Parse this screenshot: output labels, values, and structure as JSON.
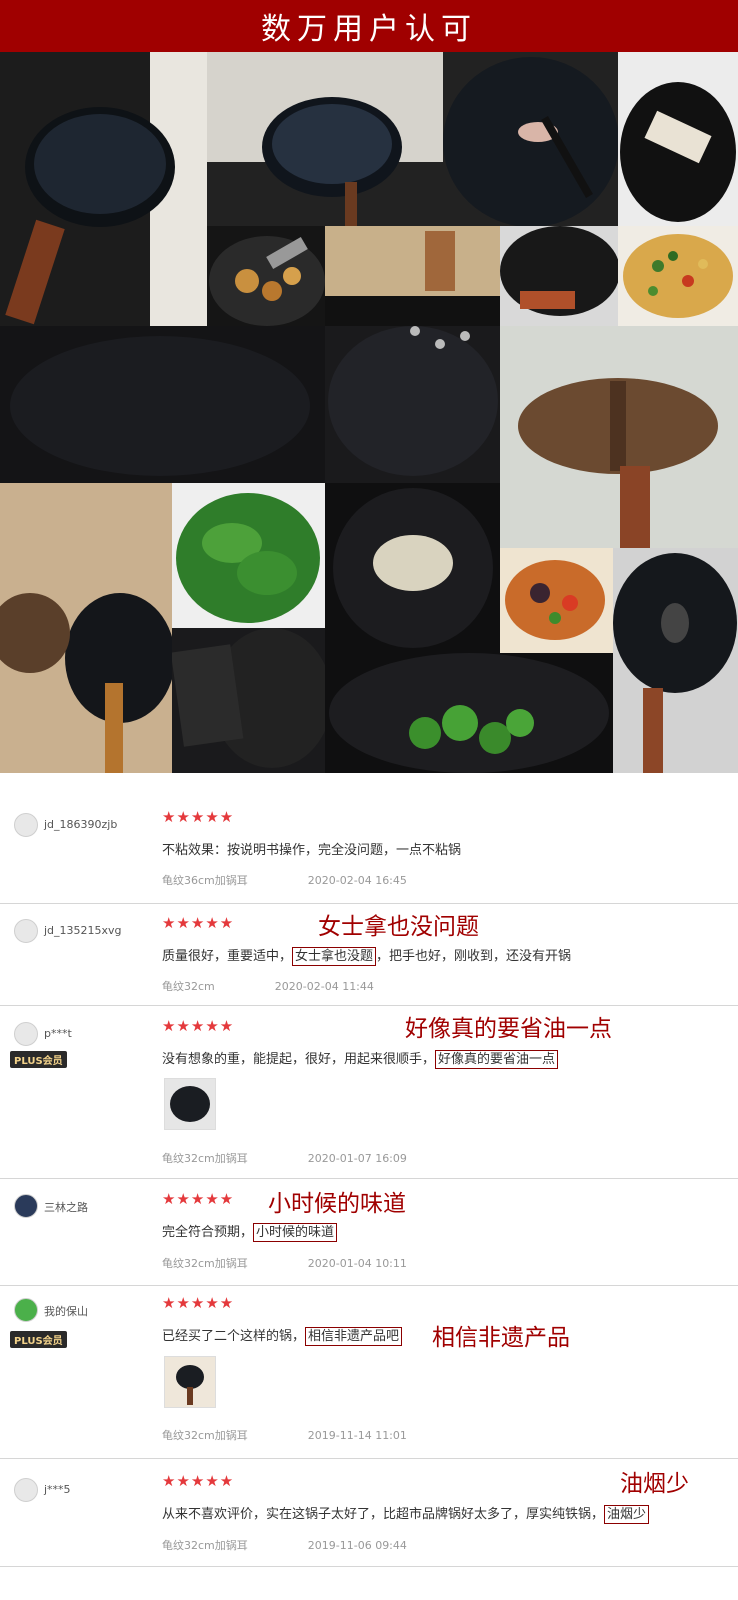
{
  "banner": {
    "title": "数万用户认可"
  },
  "reviews": [
    {
      "user": "jd_186390zjb",
      "stars": "★★★★★",
      "text_before": "不粘效果：按说明书操作，完全没问题，一点不粘锅",
      "highlight": "",
      "text_after": "",
      "spec": "龟纹36cm加锅耳",
      "date": "2020-02-04 16:45",
      "annotation": "",
      "plus": ""
    },
    {
      "user": "jd_135215xvg",
      "stars": "★★★★★",
      "text_before": "质量很好，重要适中，",
      "highlight": "女士拿也没题",
      "text_after": "，把手也好，刚收到，还没有开锅",
      "spec": "龟纹32cm",
      "date": "2020-02-04 11:44",
      "annotation": "女士拿也没问题",
      "plus": ""
    },
    {
      "user": "p***t",
      "stars": "★★★★★",
      "text_before": "没有想象的重，能提起，很好，用起来很顺手，",
      "highlight": "好像真的要省油一点",
      "text_after": "",
      "spec": "龟纹32cm加锅耳",
      "date": "2020-01-07 16:09",
      "annotation": "好像真的要省油一点",
      "plus": "PLUS会员"
    },
    {
      "user": "三林之路",
      "stars": "★★★★★",
      "text_before": "完全符合预期，",
      "highlight": "小时候的味道",
      "text_after": "",
      "spec": "龟纹32cm加锅耳",
      "date": "2020-01-04 10:11",
      "annotation": "小时候的味道",
      "plus": ""
    },
    {
      "user": "我的保山",
      "stars": "★★★★★",
      "text_before": "已经买了二个这样的锅，",
      "highlight": "相信非遗产品吧",
      "text_after": "",
      "spec": "龟纹32cm加锅耳",
      "date": "2019-11-14 11:01",
      "annotation": "相信非遗产品",
      "plus": "PLUS会员"
    },
    {
      "user": "j***5",
      "stars": "★★★★★",
      "text_before": "从来不喜欢评价，实在这锅子太好了，比超市品牌锅好太多了，厚实纯铁锅，",
      "highlight": "油烟少",
      "text_after": "",
      "spec": "龟纹32cm加锅耳",
      "date": "2019-11-06 09:44",
      "annotation": "油烟少",
      "plus": ""
    }
  ]
}
